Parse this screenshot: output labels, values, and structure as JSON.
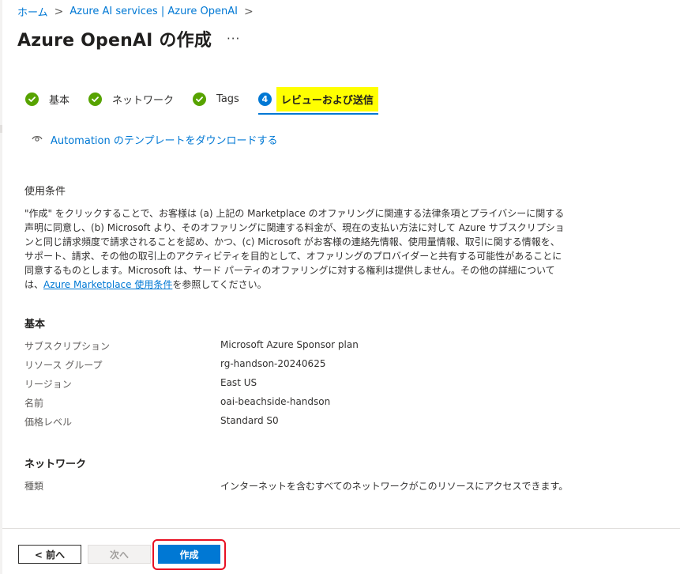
{
  "breadcrumb": {
    "items": [
      "ホーム",
      "Azure AI services | Azure OpenAI"
    ],
    "separator": ">"
  },
  "page": {
    "title": "Azure OpenAI の作成",
    "more": "···"
  },
  "steps": [
    {
      "label": "基本",
      "state": "complete"
    },
    {
      "label": "ネットワーク",
      "state": "complete"
    },
    {
      "label": "Tags",
      "state": "complete"
    },
    {
      "label": "レビューおよび送信",
      "number": "4",
      "state": "active"
    }
  ],
  "automation": {
    "label": "Automation のテンプレートをダウンロードする",
    "icon": "eye-icon"
  },
  "terms": {
    "title": "使用条件",
    "text_before": "\"作成\" をクリックすることで、お客様は (a) 上記の Marketplace のオファリングに関連する法律条項とプライバシーに関する声明に同意し、(b) Microsoft より、そのオファリングに関連する料金が、現在の支払い方法に対して Azure サブスクリプションと同じ請求頻度で請求されることを認め、かつ、(c) Microsoft がお客様の連絡先情報、使用量情報、取引に関する情報を、サポート、請求、その他の取引上のアクティビティを目的として、オファリングのプロバイダーと共有する可能性があることに同意するものとします。Microsoft は、サード パーティのオファリングに対する権利は提供しません。その他の詳細については、",
    "link": "Azure Marketplace 使用条件",
    "text_after": "を参照してください。"
  },
  "basics": {
    "title": "基本",
    "rows": [
      {
        "key": "サブスクリプション",
        "value": "Microsoft Azure Sponsor plan"
      },
      {
        "key": "リソース グループ",
        "value": "rg-handson-20240625"
      },
      {
        "key": "リージョン",
        "value": "East US"
      },
      {
        "key": "名前",
        "value": "oai-beachside-handson"
      },
      {
        "key": "価格レベル",
        "value": "Standard S0"
      }
    ]
  },
  "network": {
    "title": "ネットワーク",
    "rows": [
      {
        "key": "種類",
        "value": "インターネットを含むすべてのネットワークがこのリソースにアクセスできます。"
      }
    ]
  },
  "footer": {
    "prev_label": "< 前へ",
    "next_label": "次へ",
    "create_label": "作成"
  },
  "colors": {
    "accent": "#0078d4",
    "success": "#57a300",
    "highlight": "#ffff00",
    "callout": "#e81123"
  }
}
